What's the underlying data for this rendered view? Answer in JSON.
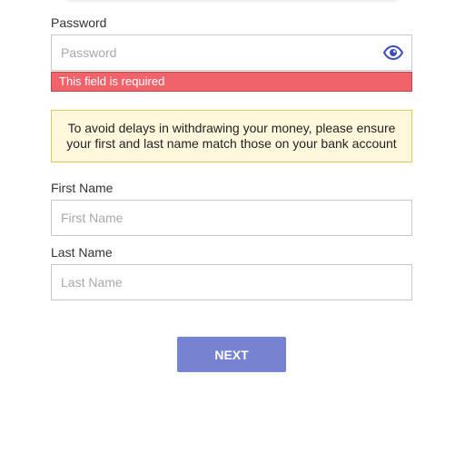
{
  "password": {
    "label": "Password",
    "placeholder": "Password",
    "value": "",
    "error": "This field is required",
    "toggle_icon": "eye-icon"
  },
  "notice": {
    "line1": "To avoid delays in withdrawing your money, please ensure",
    "line2": "your first and last name match those on your bank account"
  },
  "first_name": {
    "label": "First Name",
    "placeholder": "First Name",
    "value": ""
  },
  "last_name": {
    "label": "Last Name",
    "placeholder": "Last Name",
    "value": ""
  },
  "next_button": {
    "label": "NEXT"
  },
  "colors": {
    "error_bg": "#f0636b",
    "notice_bg": "#fff8dc",
    "notice_border": "#e9c74f",
    "button_bg": "#7583d0",
    "eye_icon": "#3f51b5"
  }
}
